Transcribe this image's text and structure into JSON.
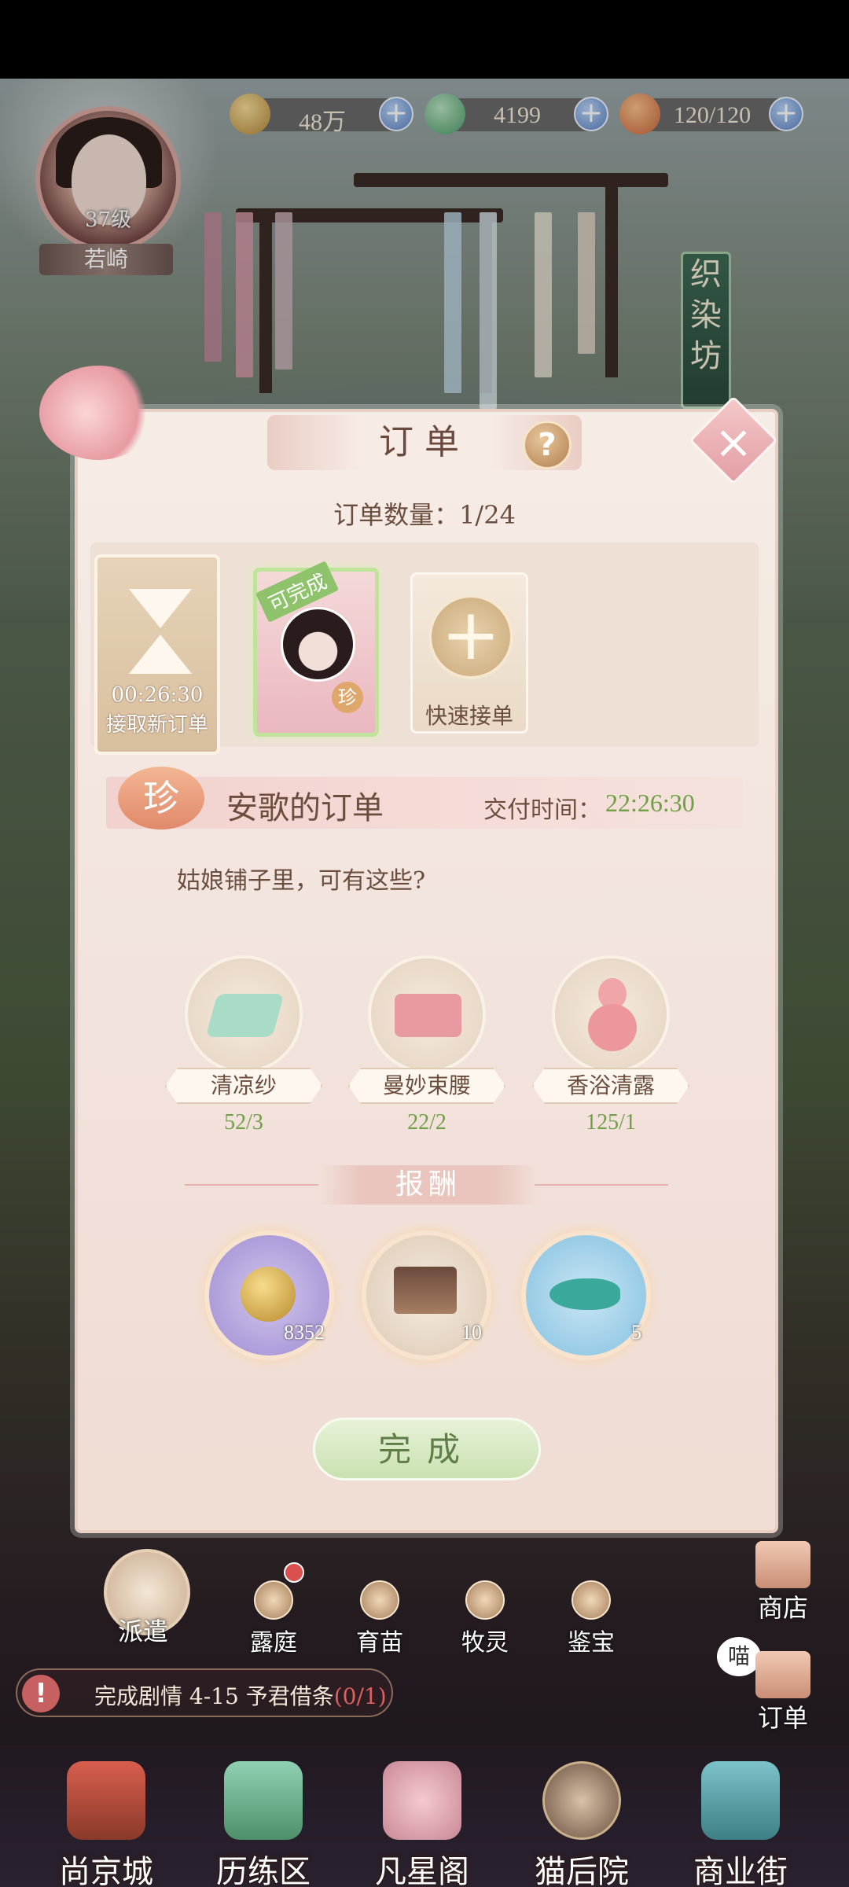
{
  "resources": [
    {
      "name": "coins",
      "value": "48万"
    },
    {
      "name": "jade",
      "value": "4199"
    },
    {
      "name": "stamina",
      "value": "120/120"
    }
  ],
  "player": {
    "level": "37级",
    "name": "若崎"
  },
  "side_banner": {
    "chars": [
      "织",
      "染",
      "坊"
    ]
  },
  "modal": {
    "title": "订单",
    "help": "?",
    "close": "×",
    "count_label": "订单数量：1/24",
    "new_order": {
      "timer": "00:26:30",
      "label": "接取新订单"
    },
    "char_card": {
      "tag": "可完成",
      "badge": "珍"
    },
    "quick": {
      "symbol": "+",
      "label": "快速接单"
    },
    "order": {
      "badge": "珍",
      "title": "安歌的订单",
      "deliver_label": "交付时间：",
      "deliver_time": "22:26:30",
      "message": "姑娘铺子里，可有这些?"
    },
    "items": [
      {
        "name": "清凉纱",
        "qty": "52/3"
      },
      {
        "name": "曼妙束腰",
        "qty": "22/2"
      },
      {
        "name": "香浴清露",
        "qty": "125/1"
      }
    ],
    "reward_title": "报酬",
    "rewards": [
      {
        "name": "cat-paw-coin",
        "amount": "8352"
      },
      {
        "name": "pavilion",
        "amount": "10"
      },
      {
        "name": "fish",
        "amount": "5"
      }
    ],
    "done_label": "完成"
  },
  "mini_nav": {
    "dispatch": "派遣",
    "items": [
      "露庭",
      "育苗",
      "牧灵",
      "鉴宝"
    ]
  },
  "task": {
    "text": "完成剧情 4-15 予君借条",
    "progress": "(0/1)"
  },
  "side_buttons": {
    "shop": "商店",
    "order": "订单",
    "meow": "喵"
  },
  "bottom_nav": [
    "尚京城",
    "历练区",
    "凡星阁",
    "猫后院",
    "商业街"
  ],
  "colors": {
    "accent_green": "#6f9f45",
    "modal_bg": "#f2e3dd",
    "title_brown": "#6b4e3d"
  }
}
